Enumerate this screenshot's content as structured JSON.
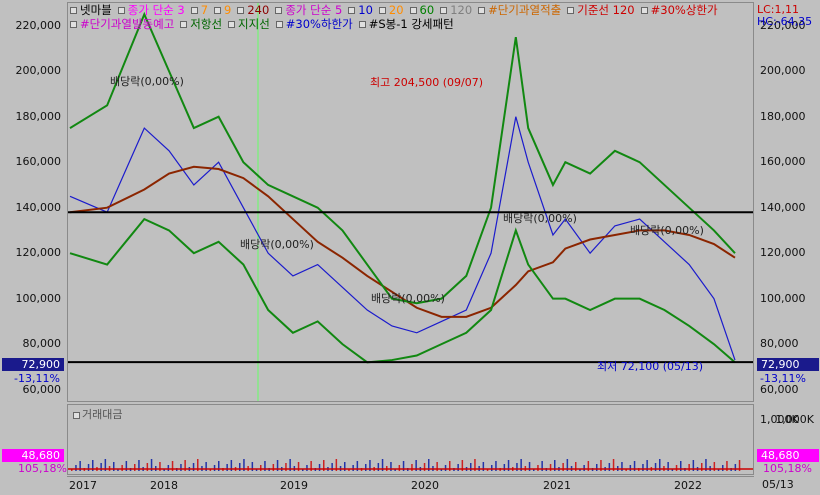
{
  "legend": {
    "row1": [
      {
        "text": "넷마블",
        "color": "#000000"
      },
      {
        "text": "종가 단순 3",
        "color": "#ff00ff"
      },
      {
        "text": "7",
        "color": "#ff8c00"
      },
      {
        "text": "9",
        "color": "#ff8c00"
      },
      {
        "text": "240",
        "color": "#8b0000"
      },
      {
        "text": "종가 단순 5",
        "color": "#cc00cc"
      },
      {
        "text": "10",
        "color": "#0000cc"
      },
      {
        "text": "20",
        "color": "#ff8c00"
      },
      {
        "text": "60",
        "color": "#008000"
      },
      {
        "text": "120",
        "color": "#808080"
      },
      {
        "text": "#단기과열적출",
        "color": "#cc6600"
      },
      {
        "text": "기준선 120",
        "color": "#cc0000"
      },
      {
        "text": "#30%상한가",
        "color": "#cc0000"
      }
    ],
    "row2": [
      {
        "text": "#단기과열발동예고",
        "color": "#cc00cc"
      },
      {
        "text": "저항선",
        "color": "#006600"
      },
      {
        "text": "지지선",
        "color": "#006600"
      },
      {
        "text": "#30%하한가",
        "color": "#0000cc"
      },
      {
        "text": "#S봉-1 강세패턴",
        "color": "#000000"
      }
    ]
  },
  "corner_right": {
    "lc": "LC:1,11",
    "hc": "HC:-64,35"
  },
  "yaxis": {
    "labels": [
      "220,000",
      "200,000",
      "180,000",
      "160,000",
      "140,000",
      "120,000",
      "100,000",
      "80,000",
      "60,000"
    ],
    "values": [
      220000,
      200000,
      180000,
      160000,
      140000,
      120000,
      100000,
      80000,
      60000
    ]
  },
  "current_price": {
    "value": "72,900",
    "pct": "-13,11%"
  },
  "volume": {
    "title": "거래대금",
    "axis_label": "1,000K",
    "value": "48,680",
    "pct": "105,18%"
  },
  "xaxis": {
    "labels": [
      "2017",
      "2018",
      "2019",
      "2020",
      "2021",
      "2022",
      "05/13"
    ]
  },
  "annotations": {
    "dividend1": "배당락(0,00%)",
    "dividend2": "배당락(0,00%)",
    "dividend3": "배당락(0,00%)",
    "dividend4": "배당락(0,00%)",
    "dividend5": "배당락(0,00%)",
    "high": "최고 204,500 (09/07)",
    "low": "최저 72,100 (05/13)"
  },
  "chart_data": {
    "type": "line",
    "ylim": [
      55000,
      230000
    ],
    "reference_lines": [
      138000,
      72100
    ],
    "x": [
      2017.0,
      2017.3,
      2017.6,
      2017.8,
      2018.0,
      2018.2,
      2018.4,
      2018.6,
      2018.8,
      2019.0,
      2019.2,
      2019.4,
      2019.6,
      2019.8,
      2020.0,
      2020.2,
      2020.4,
      2020.6,
      2020.7,
      2020.9,
      2021.0,
      2021.2,
      2021.4,
      2021.6,
      2021.8,
      2022.0,
      2022.2,
      2022.37
    ],
    "series": [
      {
        "name": "close",
        "values": [
          145000,
          138000,
          175000,
          165000,
          150000,
          160000,
          140000,
          120000,
          110000,
          115000,
          105000,
          95000,
          88000,
          85000,
          90000,
          95000,
          120000,
          180000,
          160000,
          128000,
          135000,
          120000,
          132000,
          135000,
          125000,
          115000,
          100000,
          73000
        ]
      },
      {
        "name": "240",
        "values": [
          138000,
          140000,
          148000,
          155000,
          158000,
          157000,
          153000,
          145000,
          135000,
          125000,
          118000,
          110000,
          103000,
          96000,
          92000,
          92000,
          96000,
          106000,
          112000,
          116000,
          122000,
          126000,
          128000,
          130000,
          130000,
          128000,
          124000,
          118000
        ]
      },
      {
        "name": "resistance",
        "values": [
          175000,
          185000,
          225000,
          200000,
          175000,
          180000,
          160000,
          150000,
          145000,
          140000,
          130000,
          115000,
          100000,
          98000,
          100000,
          110000,
          140000,
          215000,
          175000,
          150000,
          160000,
          155000,
          165000,
          160000,
          150000,
          140000,
          130000,
          120000
        ]
      },
      {
        "name": "support",
        "values": [
          120000,
          115000,
          135000,
          130000,
          120000,
          125000,
          115000,
          95000,
          85000,
          90000,
          80000,
          72000,
          73000,
          75000,
          80000,
          85000,
          95000,
          130000,
          115000,
          100000,
          100000,
          95000,
          100000,
          100000,
          95000,
          88000,
          80000,
          72000
        ]
      }
    ]
  }
}
